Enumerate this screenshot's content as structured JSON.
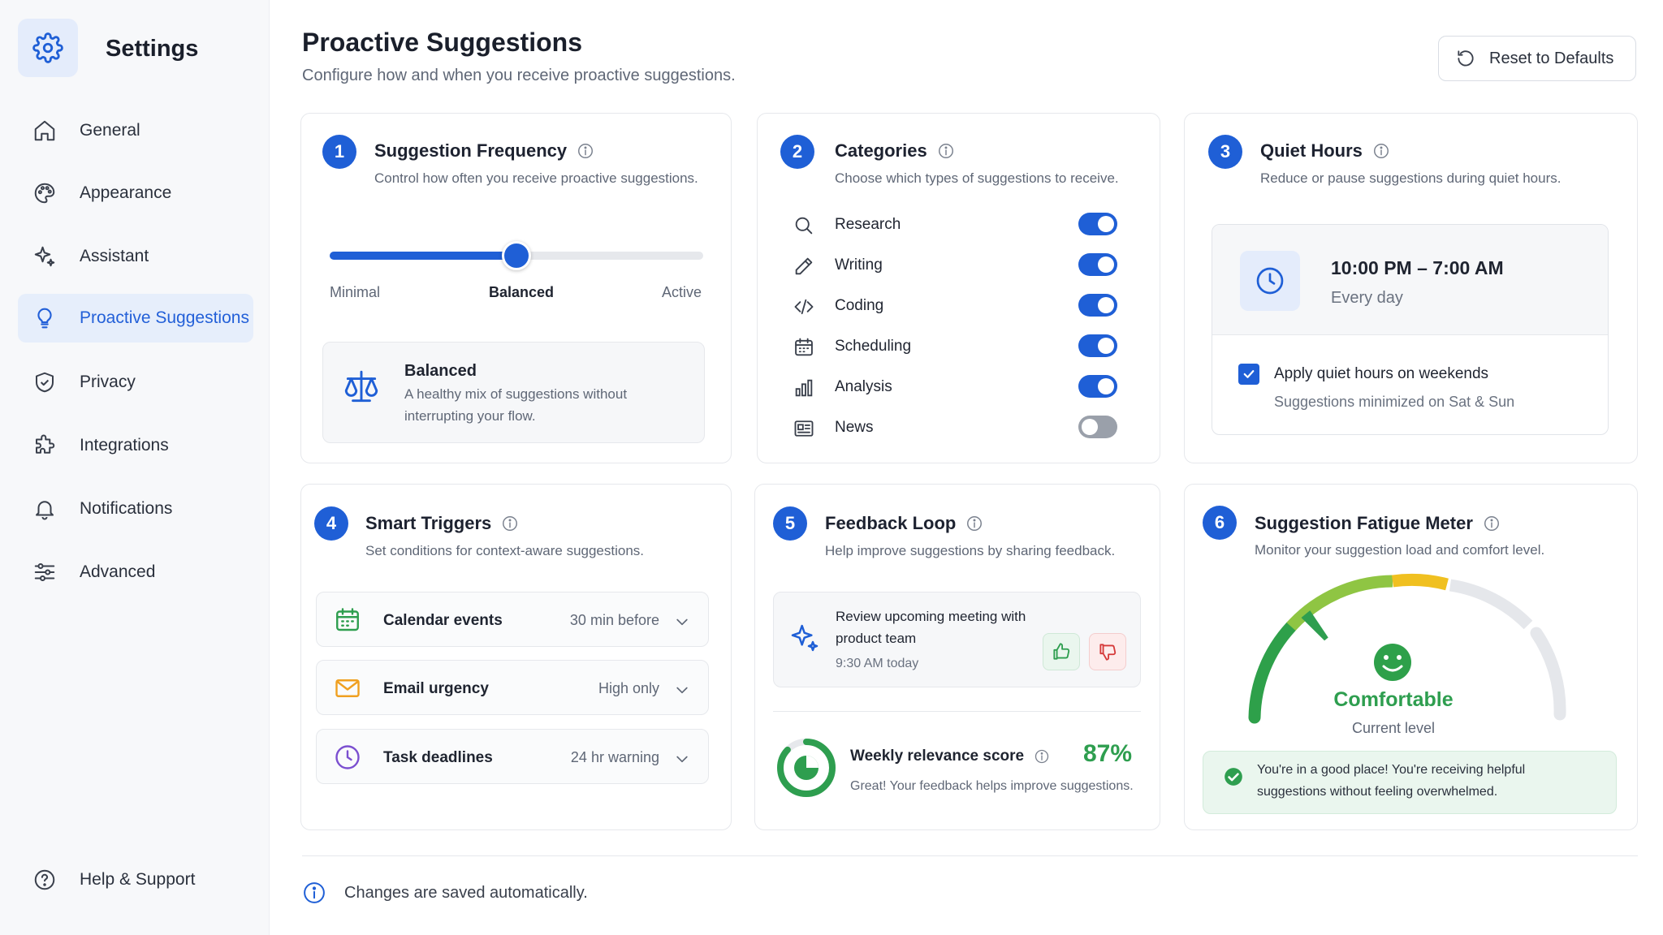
{
  "app": {
    "title": "Settings"
  },
  "sidebar": {
    "items": [
      {
        "label": "General",
        "icon": "home-icon"
      },
      {
        "label": "Appearance",
        "icon": "palette-icon"
      },
      {
        "label": "Assistant",
        "icon": "sparkle-icon"
      },
      {
        "label": "Proactive Suggestions",
        "icon": "lightbulb-icon",
        "active": true
      },
      {
        "label": "Privacy",
        "icon": "shield-icon"
      },
      {
        "label": "Integrations",
        "icon": "puzzle-icon"
      },
      {
        "label": "Notifications",
        "icon": "bell-icon"
      },
      {
        "label": "Advanced",
        "icon": "sliders-icon"
      }
    ],
    "help": {
      "label": "Help & Support",
      "icon": "help-icon"
    }
  },
  "header": {
    "title": "Proactive Suggestions",
    "subtitle": "Configure how and when you receive proactive suggestions.",
    "reset_label": "Reset to Defaults"
  },
  "frequency": {
    "number": "1",
    "title": "Suggestion Frequency",
    "subtitle": "Control how often you receive proactive suggestions.",
    "slider_value": 0.5,
    "labels": {
      "min": "Minimal",
      "mid": "Balanced",
      "max": "Active"
    },
    "summary_title": "Balanced",
    "summary_line1": "A healthy mix of suggestions without",
    "summary_line2": "interrupting your flow."
  },
  "categories": {
    "number": "2",
    "title": "Categories",
    "subtitle": "Choose which types of suggestions to receive.",
    "items": [
      {
        "label": "Research",
        "icon": "search-icon",
        "enabled": true
      },
      {
        "label": "Writing",
        "icon": "pencil-icon",
        "enabled": true
      },
      {
        "label": "Coding",
        "icon": "code-icon",
        "enabled": true
      },
      {
        "label": "Scheduling",
        "icon": "calendar-icon",
        "enabled": true
      },
      {
        "label": "Analysis",
        "icon": "bar-chart-icon",
        "enabled": true
      },
      {
        "label": "News",
        "icon": "newspaper-icon",
        "enabled": false
      }
    ]
  },
  "quiet_hours": {
    "number": "3",
    "title": "Quiet Hours",
    "subtitle": "Reduce or pause suggestions during quiet hours.",
    "time_range": "10:00 PM – 7:00 AM",
    "repeat": "Every day",
    "weekend_label": "Apply quiet hours on weekends",
    "weekend_checked": true,
    "weekend_note": "Suggestions minimized on Sat & Sun"
  },
  "smart_triggers": {
    "number": "4",
    "title": "Smart Triggers",
    "subtitle": "Set conditions for context-aware suggestions.",
    "items": [
      {
        "label": "Calendar events",
        "value": "30 min before",
        "icon": "calendar-icon",
        "color": "#2e9e4f"
      },
      {
        "label": "Email urgency",
        "value": "High only",
        "icon": "mail-icon",
        "color": "#f0a020"
      },
      {
        "label": "Task deadlines",
        "value": "24 hr warning",
        "icon": "clock-icon",
        "color": "#7b4fd0"
      }
    ]
  },
  "feedback": {
    "number": "5",
    "title": "Feedback Loop",
    "subtitle": "Help improve suggestions by sharing feedback.",
    "suggestion_line1": "Review upcoming meeting with",
    "suggestion_line2": "product team",
    "suggestion_time": "9:30 AM today",
    "score_label": "Weekly relevance score",
    "score_value": "87%",
    "score_fraction": 0.87,
    "score_note": "Great! Your feedback helps improve suggestions."
  },
  "fatigue": {
    "number": "6",
    "title": "Suggestion Fatigue Meter",
    "subtitle": "Monitor your suggestion load and comfort level.",
    "level_fraction": 0.28,
    "status": "Comfortable",
    "status_caption": "Current level",
    "message_line1": "You're in a good place! You're receiving helpful",
    "message_line2": "suggestions without feeling overwhelmed."
  },
  "footer": {
    "note": "Changes are saved automatically."
  },
  "colors": {
    "accent": "#1f5fd6",
    "success": "#2e9e4f",
    "warning": "#f0c020",
    "danger": "#d63a3a"
  }
}
